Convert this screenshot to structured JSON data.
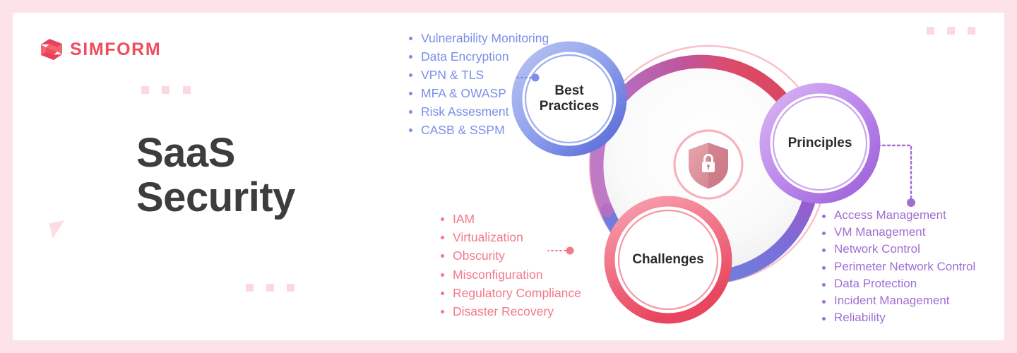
{
  "brand": {
    "name": "SIMFORM",
    "logo_icon": "simform-s-logo-icon",
    "color": "#ef4c5d"
  },
  "title": {
    "line1": "SaaS",
    "line2": "Security"
  },
  "theme": {
    "page_background": "#fde3e7",
    "card_background": "#ffffff",
    "title_color": "#3d3d3d",
    "best_practices_color": "#7b8fe8",
    "challenges_color": "#f2798a",
    "principles_color": "#a06fd2",
    "shield_color": "#dd8b96",
    "decor_color": "#fcd9de"
  },
  "diagram": {
    "center_icon": "shield-lock-icon",
    "nodes": [
      {
        "id": "best-practices",
        "label_line1": "Best",
        "label_line2": "Practices",
        "color": "#7b8fe8"
      },
      {
        "id": "principles",
        "label_line1": "Principles",
        "label_line2": "",
        "color": "#a06fd2"
      },
      {
        "id": "challenges",
        "label_line1": "Challenges",
        "label_line2": "",
        "color": "#f2798a"
      }
    ]
  },
  "lists": {
    "best_practices": {
      "items": [
        "Vulnerability Monitoring",
        "Data Encryption",
        "VPN & TLS",
        "MFA & OWASP",
        "Risk Assesment",
        "CASB & SSPM"
      ]
    },
    "challenges": {
      "items": [
        "IAM",
        "Virtualization",
        "Obscurity",
        "Misconfiguration",
        "Regulatory Compliance",
        "Disaster Recovery"
      ]
    },
    "principles": {
      "items": [
        "Access Management",
        "VM Management",
        "Network Control",
        "Perimeter Network Control",
        "Data Protection",
        "Incident Management",
        "Reliability"
      ]
    }
  }
}
